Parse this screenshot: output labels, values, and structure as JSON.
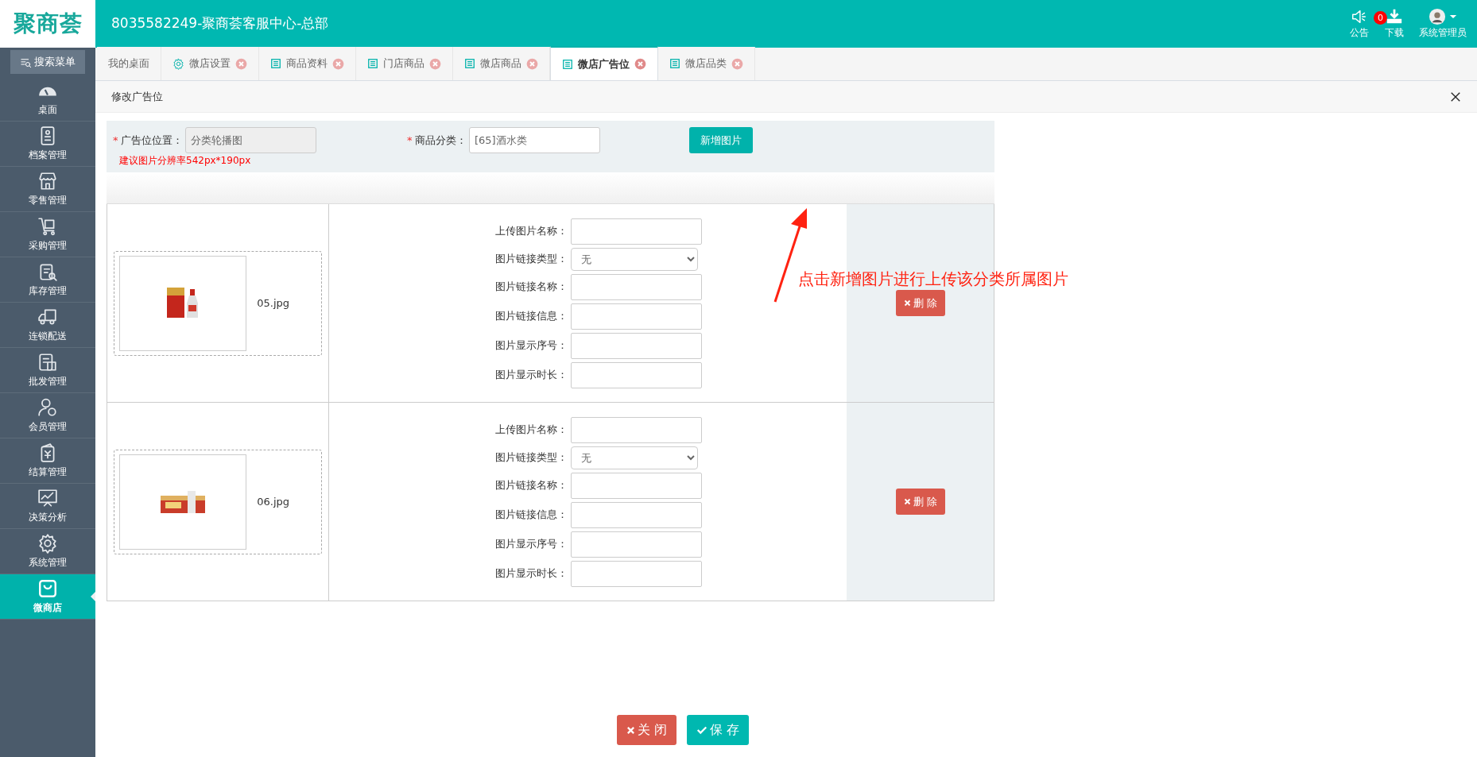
{
  "header": {
    "logo": "聚商荟",
    "title": "8035582249-聚商荟客服中心-总部",
    "actions": [
      {
        "kind": "notice",
        "label": "公告",
        "badge": "0"
      },
      {
        "kind": "download",
        "label": "下载"
      },
      {
        "kind": "user",
        "label": "系统管理员"
      }
    ]
  },
  "sidebar": {
    "search_button": "搜索菜单",
    "items": [
      {
        "label": "桌面",
        "selected": false
      },
      {
        "label": "档案管理",
        "selected": false
      },
      {
        "label": "零售管理",
        "selected": false
      },
      {
        "label": "采购管理",
        "selected": false
      },
      {
        "label": "库存管理",
        "selected": false
      },
      {
        "label": "连锁配送",
        "selected": false
      },
      {
        "label": "批发管理",
        "selected": false
      },
      {
        "label": "会员管理",
        "selected": false
      },
      {
        "label": "结算管理",
        "selected": false
      },
      {
        "label": "决策分析",
        "selected": false
      },
      {
        "label": "系统管理",
        "selected": false
      },
      {
        "label": "微商店",
        "selected": true
      }
    ]
  },
  "tabs": [
    {
      "kind": "home",
      "label": "我的桌面",
      "closable": false,
      "selected": false
    },
    {
      "kind": "settings",
      "label": "微店设置",
      "closable": true,
      "selected": false
    },
    {
      "kind": "list",
      "label": "商品资料",
      "closable": true,
      "selected": false
    },
    {
      "kind": "list",
      "label": "门店商品",
      "closable": true,
      "selected": false
    },
    {
      "kind": "list",
      "label": "微店商品",
      "closable": true,
      "selected": false
    },
    {
      "kind": "list",
      "label": "微店广告位",
      "closable": true,
      "selected": true
    },
    {
      "kind": "list",
      "label": "微店品类",
      "closable": true,
      "selected": false
    }
  ],
  "panel": {
    "title": "修改广告位",
    "form": {
      "fields": [
        {
          "required_mark": "*",
          "label": "广告位位置：",
          "value": "分类轮播图",
          "disabled": true
        },
        {
          "required_mark": "*",
          "label": "商品分类：",
          "value": "[65]酒水类",
          "disabled": false
        }
      ],
      "hint": "建议图片分辨率542px*190px",
      "add_button": "新增图片"
    },
    "annotation": "点击新增图片进行上传该分类所属图片",
    "images": [
      {
        "file_name": "05.jpg",
        "delete_button": "删 除",
        "fields": [
          {
            "kind": "text",
            "label": "上传图片名称："
          },
          {
            "kind": "select",
            "label": "图片链接类型：",
            "value": "无"
          },
          {
            "kind": "text",
            "label": "图片链接名称："
          },
          {
            "kind": "text",
            "label": "图片链接信息："
          },
          {
            "kind": "text",
            "label": "图片显示序号："
          },
          {
            "kind": "text",
            "label": "图片显示时长："
          }
        ]
      },
      {
        "file_name": "06.jpg",
        "delete_button": "删 除",
        "fields": [
          {
            "kind": "text",
            "label": "上传图片名称："
          },
          {
            "kind": "select",
            "label": "图片链接类型：",
            "value": "无"
          },
          {
            "kind": "text",
            "label": "图片链接名称："
          },
          {
            "kind": "text",
            "label": "图片链接信息："
          },
          {
            "kind": "text",
            "label": "图片显示序号："
          },
          {
            "kind": "text",
            "label": "图片显示时长："
          }
        ]
      }
    ],
    "footer_buttons": [
      {
        "kind": "close",
        "label": "关 闭"
      },
      {
        "kind": "save",
        "label": "保 存"
      }
    ]
  }
}
